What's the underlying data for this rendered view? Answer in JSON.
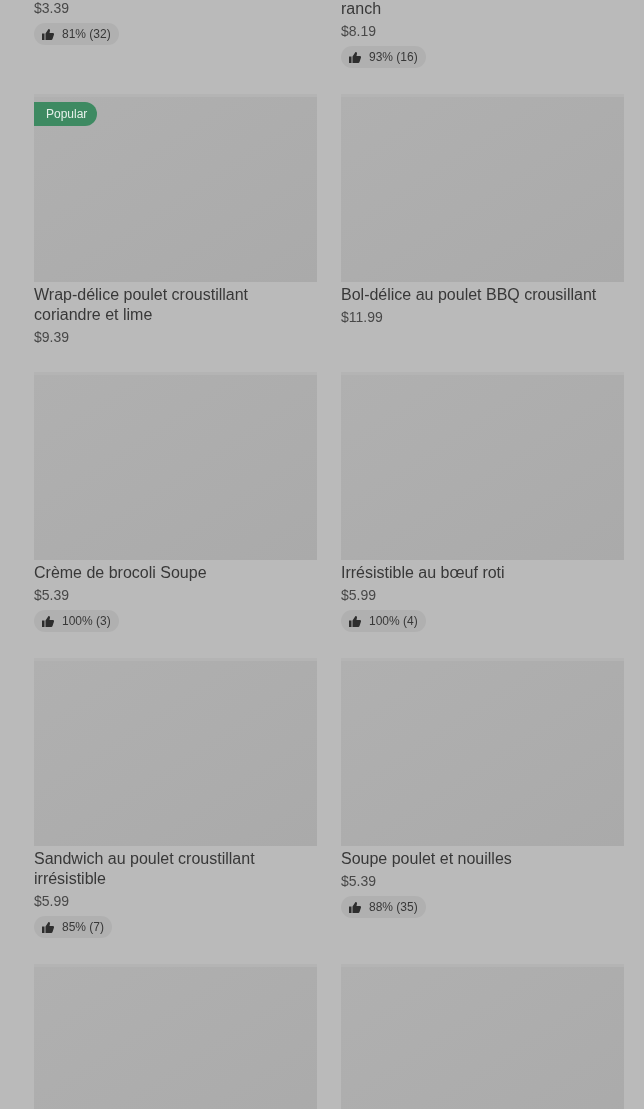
{
  "items": [
    {
      "image": false,
      "price": "$3.39",
      "rating": "81% (32)"
    },
    {
      "image": false,
      "title": "ranch",
      "price": "$8.19",
      "rating": "93% (16)"
    },
    {
      "image": true,
      "badge": "Popular",
      "title": "Wrap-délice poulet croustillant coriandre et lime",
      "price": "$9.39"
    },
    {
      "image": true,
      "title": "Bol-délice au poulet BBQ crousillant",
      "price": "$11.99"
    },
    {
      "image": true,
      "title": "Crème de brocoli Soupe",
      "price": "$5.39",
      "rating": "100% (3)"
    },
    {
      "image": true,
      "title": "Irrésistible au bœuf roti",
      "price": "$5.99",
      "rating": "100% (4)"
    },
    {
      "image": true,
      "title": "Sandwich au poulet croustillant irrésistible",
      "price": "$5.99",
      "rating": "85% (7)"
    },
    {
      "image": true,
      "title": "Soupe poulet et nouilles",
      "price": "$5.39",
      "rating": "88% (35)"
    },
    {
      "image": true
    },
    {
      "image": true
    }
  ]
}
